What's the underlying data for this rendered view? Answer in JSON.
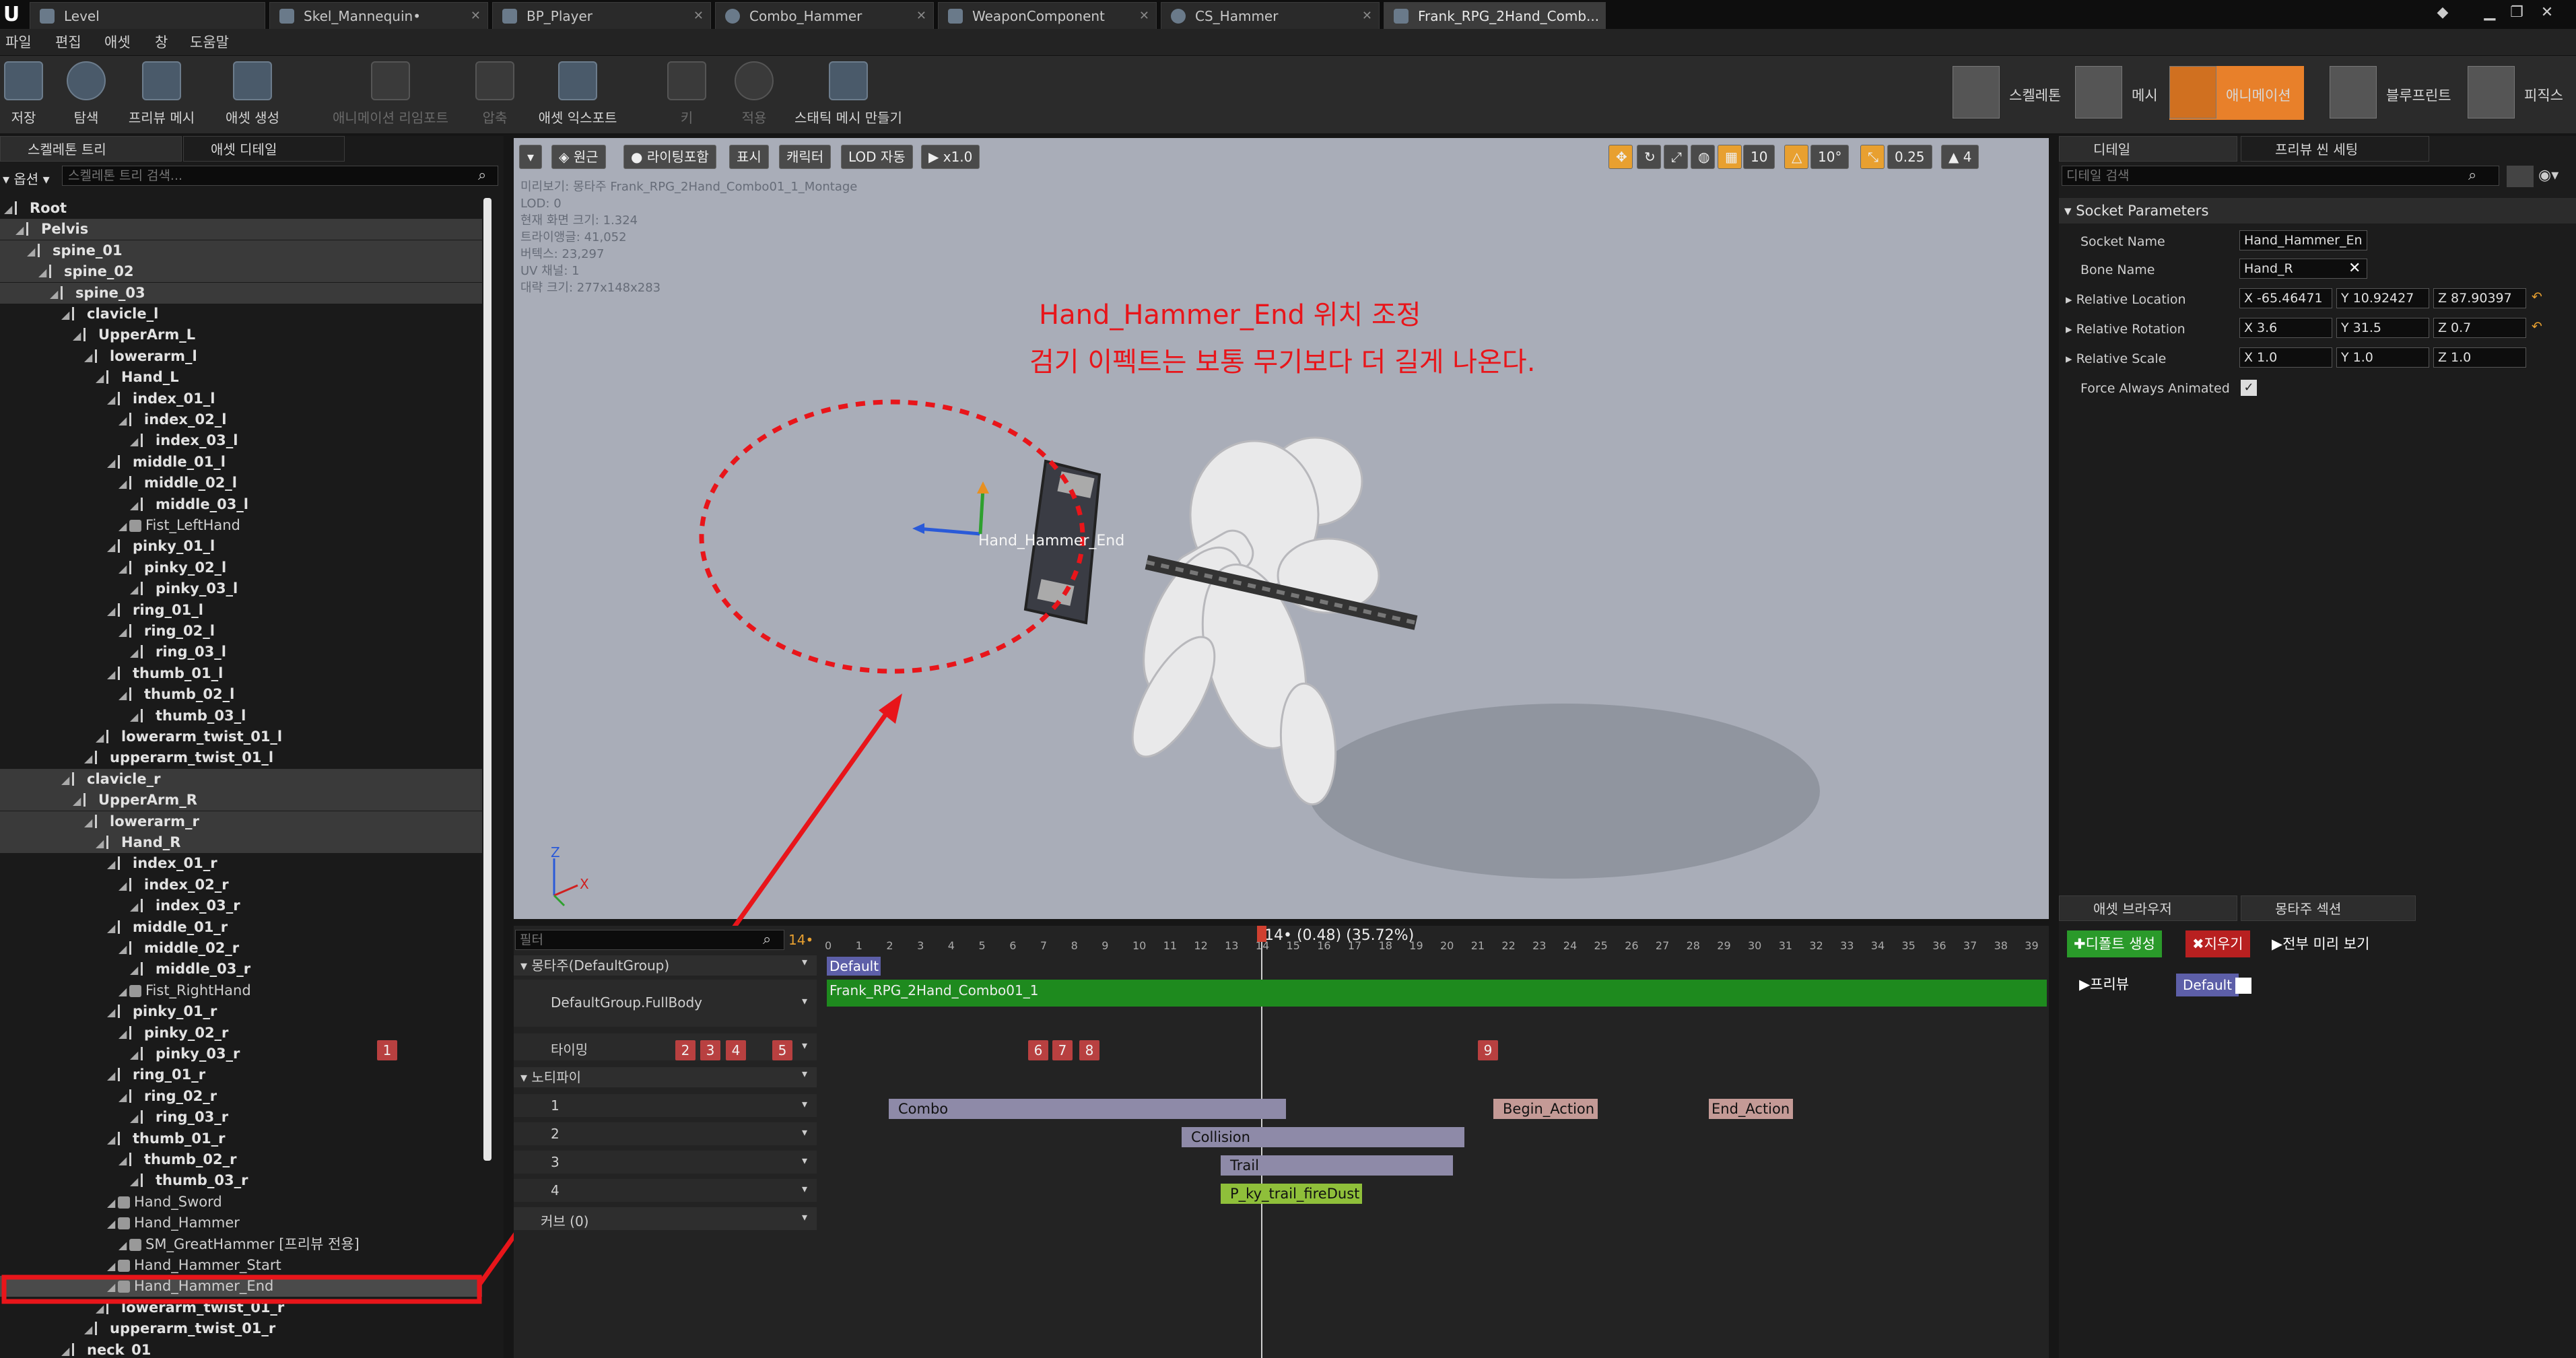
{
  "tabs": [
    {
      "label": "Level"
    },
    {
      "label": "Skel_Mannequin•"
    },
    {
      "label": "BP_Player"
    },
    {
      "label": "Combo_Hammer"
    },
    {
      "label": "WeaponComponent"
    },
    {
      "label": "CS_Hammer"
    },
    {
      "label": "Frank_RPG_2Hand_Comb..."
    }
  ],
  "menu": [
    "파일",
    "편집",
    "애셋",
    "창",
    "도움말"
  ],
  "toolbar": [
    {
      "label": "저장"
    },
    {
      "label": "탐색"
    },
    {
      "label": "프리뷰 메시"
    },
    {
      "label": "애셋 생성"
    },
    {
      "label": "애니메이션 리임포트"
    },
    {
      "label": "압축"
    },
    {
      "label": "애셋 익스포트"
    },
    {
      "label": "키"
    },
    {
      "label": "적용"
    },
    {
      "label": "스태틱 메시 만들기"
    }
  ],
  "modes": [
    {
      "label": "스켈레톤"
    },
    {
      "label": "메시"
    },
    {
      "label": "애니메이션"
    },
    {
      "label": "블루프린트"
    },
    {
      "label": "피직스"
    }
  ],
  "left": {
    "tab1": "스켈레톤 트리",
    "tab2": "애셋 디테일",
    "options": "옵션",
    "search_placeholder": "스켈레톤 트리 검색...",
    "tree": [
      {
        "t": "Root",
        "d": 0,
        "k": "b"
      },
      {
        "t": "Pelvis",
        "d": 1,
        "k": "b",
        "h": 1
      },
      {
        "t": "spine_01",
        "d": 2,
        "k": "b",
        "h": 1
      },
      {
        "t": "spine_02",
        "d": 3,
        "k": "b",
        "h": 1
      },
      {
        "t": "spine_03",
        "d": 4,
        "k": "b",
        "h": 1
      },
      {
        "t": "clavicle_l",
        "d": 5,
        "k": "b"
      },
      {
        "t": "UpperArm_L",
        "d": 6,
        "k": "b"
      },
      {
        "t": "lowerarm_l",
        "d": 7,
        "k": "b"
      },
      {
        "t": "Hand_L",
        "d": 8,
        "k": "b"
      },
      {
        "t": "index_01_l",
        "d": 9,
        "k": "b"
      },
      {
        "t": "index_02_l",
        "d": 10,
        "k": "b"
      },
      {
        "t": "index_03_l",
        "d": 11,
        "k": "b"
      },
      {
        "t": "middle_01_l",
        "d": 9,
        "k": "b"
      },
      {
        "t": "middle_02_l",
        "d": 10,
        "k": "b"
      },
      {
        "t": "middle_03_l",
        "d": 11,
        "k": "b"
      },
      {
        "t": "Fist_LeftHand",
        "d": 10,
        "k": "s"
      },
      {
        "t": "pinky_01_l",
        "d": 9,
        "k": "b"
      },
      {
        "t": "pinky_02_l",
        "d": 10,
        "k": "b"
      },
      {
        "t": "pinky_03_l",
        "d": 11,
        "k": "b"
      },
      {
        "t": "ring_01_l",
        "d": 9,
        "k": "b"
      },
      {
        "t": "ring_02_l",
        "d": 10,
        "k": "b"
      },
      {
        "t": "ring_03_l",
        "d": 11,
        "k": "b"
      },
      {
        "t": "thumb_01_l",
        "d": 9,
        "k": "b"
      },
      {
        "t": "thumb_02_l",
        "d": 10,
        "k": "b"
      },
      {
        "t": "thumb_03_l",
        "d": 11,
        "k": "b"
      },
      {
        "t": "lowerarm_twist_01_l",
        "d": 8,
        "k": "b"
      },
      {
        "t": "upperarm_twist_01_l",
        "d": 7,
        "k": "b"
      },
      {
        "t": "clavicle_r",
        "d": 5,
        "k": "b",
        "h": 1
      },
      {
        "t": "UpperArm_R",
        "d": 6,
        "k": "b",
        "h": 1
      },
      {
        "t": "lowerarm_r",
        "d": 7,
        "k": "b",
        "h": 1
      },
      {
        "t": "Hand_R",
        "d": 8,
        "k": "b",
        "h": 1
      },
      {
        "t": "index_01_r",
        "d": 9,
        "k": "b"
      },
      {
        "t": "index_02_r",
        "d": 10,
        "k": "b"
      },
      {
        "t": "index_03_r",
        "d": 11,
        "k": "b"
      },
      {
        "t": "middle_01_r",
        "d": 9,
        "k": "b"
      },
      {
        "t": "middle_02_r",
        "d": 10,
        "k": "b"
      },
      {
        "t": "middle_03_r",
        "d": 11,
        "k": "b"
      },
      {
        "t": "Fist_RightHand",
        "d": 10,
        "k": "s"
      },
      {
        "t": "pinky_01_r",
        "d": 9,
        "k": "b"
      },
      {
        "t": "pinky_02_r",
        "d": 10,
        "k": "b"
      },
      {
        "t": "pinky_03_r",
        "d": 11,
        "k": "b"
      },
      {
        "t": "ring_01_r",
        "d": 9,
        "k": "b"
      },
      {
        "t": "ring_02_r",
        "d": 10,
        "k": "b"
      },
      {
        "t": "ring_03_r",
        "d": 11,
        "k": "b"
      },
      {
        "t": "thumb_01_r",
        "d": 9,
        "k": "b"
      },
      {
        "t": "thumb_02_r",
        "d": 10,
        "k": "b"
      },
      {
        "t": "thumb_03_r",
        "d": 11,
        "k": "b"
      },
      {
        "t": "Hand_Sword",
        "d": 9,
        "k": "s"
      },
      {
        "t": "Hand_Hammer",
        "d": 9,
        "k": "s"
      },
      {
        "t": "SM_GreatHammer [프리뷰 전용]",
        "d": 10,
        "k": "m"
      },
      {
        "t": "Hand_Hammer_Start",
        "d": 9,
        "k": "s"
      },
      {
        "t": "Hand_Hammer_End",
        "d": 9,
        "k": "s",
        "sel": 1
      },
      {
        "t": "lowerarm_twist_01_r",
        "d": 8,
        "k": "b"
      },
      {
        "t": "upperarm_twist_01_r",
        "d": 7,
        "k": "b"
      },
      {
        "t": "neck_01",
        "d": 5,
        "k": "b"
      }
    ]
  },
  "viewport": {
    "buttons": [
      "원근",
      "라이팅포함",
      "표시",
      "캐릭터",
      "LOD 자동",
      "x1.0"
    ],
    "right_values": [
      "10",
      "10°",
      "0.25",
      "4"
    ],
    "stats": [
      "미리보기: 몽타주 Frank_RPG_2Hand_Combo01_1_Montage",
      "LOD: 0",
      "현재 화면 크기: 1.324",
      "트라이앵글: 41,052",
      "버텍스: 23,297",
      "UV 채널: 1",
      "대략 크기: 277x148x283"
    ],
    "anno1": "Hand_Hammer_End 위치 조정",
    "anno2": "검기 이펙트는 보통 무기보다 더 길게 나온다.",
    "socket_label": "Hand_Hammer_End"
  },
  "timeline": {
    "filter_placeholder": "필터",
    "frame_field": "14•",
    "playhead": "14• (0.48) (35.72%)",
    "ticks": [
      "0",
      "1",
      "2",
      "3",
      "4",
      "5",
      "6",
      "7",
      "8",
      "9",
      "10",
      "11",
      "12",
      "13",
      "14",
      "15",
      "16",
      "17",
      "18",
      "19",
      "20",
      "21",
      "22",
      "23",
      "24",
      "25",
      "26",
      "27",
      "28",
      "29",
      "30",
      "31",
      "32",
      "33",
      "34",
      "35",
      "36",
      "37",
      "38",
      "39"
    ],
    "montage_group": "몽타주(DefaultGroup)",
    "slot": "DefaultGroup.FullBody",
    "default_section": "Default",
    "anim_name": "Frank_RPG_2Hand_Combo01_1",
    "timing": "타이밍",
    "notify": "노티파이",
    "curve": "커브 (0)",
    "notify_tracks": [
      "1",
      "2",
      "3",
      "4"
    ],
    "timing_marks": [
      "1",
      "2",
      "3",
      "4",
      "5",
      "6",
      "7",
      "8",
      "9"
    ],
    "notifies": [
      {
        "label": "Combo"
      },
      {
        "label": "Collision"
      },
      {
        "label": "Trail"
      },
      {
        "label": "P_ky_trail_fireDust"
      },
      {
        "label": "Begin_Action"
      },
      {
        "label": "End_Action"
      }
    ]
  },
  "right": {
    "tab1": "디테일",
    "tab2": "프리뷰 씬 세팅",
    "search_placeholder": "디테일 검색",
    "section": "Socket Parameters",
    "socket_name_label": "Socket Name",
    "socket_name": "Hand_Hammer_En",
    "bone_name_label": "Bone Name",
    "bone_name": "Hand_R",
    "loc_label": "Relative Location",
    "loc": [
      "X -65.46471",
      "Y 10.92427",
      "Z 87.90397"
    ],
    "rot_label": "Relative Rotation",
    "rot": [
      "X 3.6",
      "Y 31.5",
      "Z 0.7"
    ],
    "scale_label": "Relative Scale",
    "scale": [
      "X 1.0",
      "Y 1.0",
      "Z 1.0"
    ],
    "force_label": "Force Always Animated",
    "tab3": "애셋 브라우저",
    "tab4": "몽타주 섹션",
    "btn_default": "디폴트 생성",
    "btn_clear": "지우기",
    "btn_preview_all": "전부 미리 보기",
    "preview_label": "프리뷰",
    "preview_default": "Default"
  },
  "colors": {
    "accent": "#e8151a",
    "notify_purple": "#8e8aa8",
    "notify_green": "#8fbf3a",
    "notify_pink": "#c49a96",
    "anim_green": "#1e8a1e",
    "mode_active": "#e8802a"
  }
}
